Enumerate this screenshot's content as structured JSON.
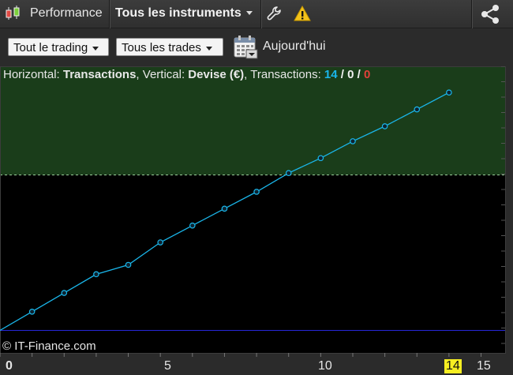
{
  "titlebar": {
    "title": "Performance",
    "instrument": "Tous les instruments"
  },
  "toolbar": {
    "trading_filter": "Tout le trading",
    "trades_filter": "Tous les trades",
    "date_label": "Aujourd'hui"
  },
  "info": {
    "horizontal_label": "Horizontal:",
    "horizontal_value": "Transactions",
    "vertical_label": "Vertical:",
    "vertical_value": "Devise (€)",
    "transactions_label": "Transactions:",
    "count_total": "14",
    "count_mid": "0",
    "count_neg": "0",
    "sep1": "/",
    "sep2": "/",
    "comma1": ",",
    "comma2": ","
  },
  "copyright": "© IT-Finance.com",
  "icons": {
    "app": "candlestick-icon",
    "settings": "wrench-icon",
    "alert": "warning-icon",
    "share": "share-icon",
    "calendar": "calendar-icon"
  },
  "colors": {
    "line": "#1ab6ea",
    "positive_zone": "#1a3d1a",
    "zero_line": "#2727d8",
    "highlight": "#f6ee22",
    "transactions_count": "#1ab6ea",
    "negative_count": "#e0413a"
  },
  "chart_data": {
    "type": "line",
    "x": [
      0,
      1,
      2,
      3,
      4,
      5,
      6,
      7,
      8,
      9,
      10,
      11,
      12,
      13,
      14
    ],
    "y": [
      0,
      1.0,
      2.0,
      3.0,
      3.5,
      4.7,
      5.6,
      6.5,
      7.4,
      8.4,
      9.2,
      10.1,
      10.9,
      11.8,
      12.7
    ],
    "xlim": [
      0,
      15.75
    ],
    "ylim": [
      -1.2,
      14.1
    ],
    "x_ticks": [
      "0",
      "5",
      "10",
      "15"
    ],
    "x_highlight_label": "14",
    "profit_zone_y": 8.3,
    "grid": false
  }
}
